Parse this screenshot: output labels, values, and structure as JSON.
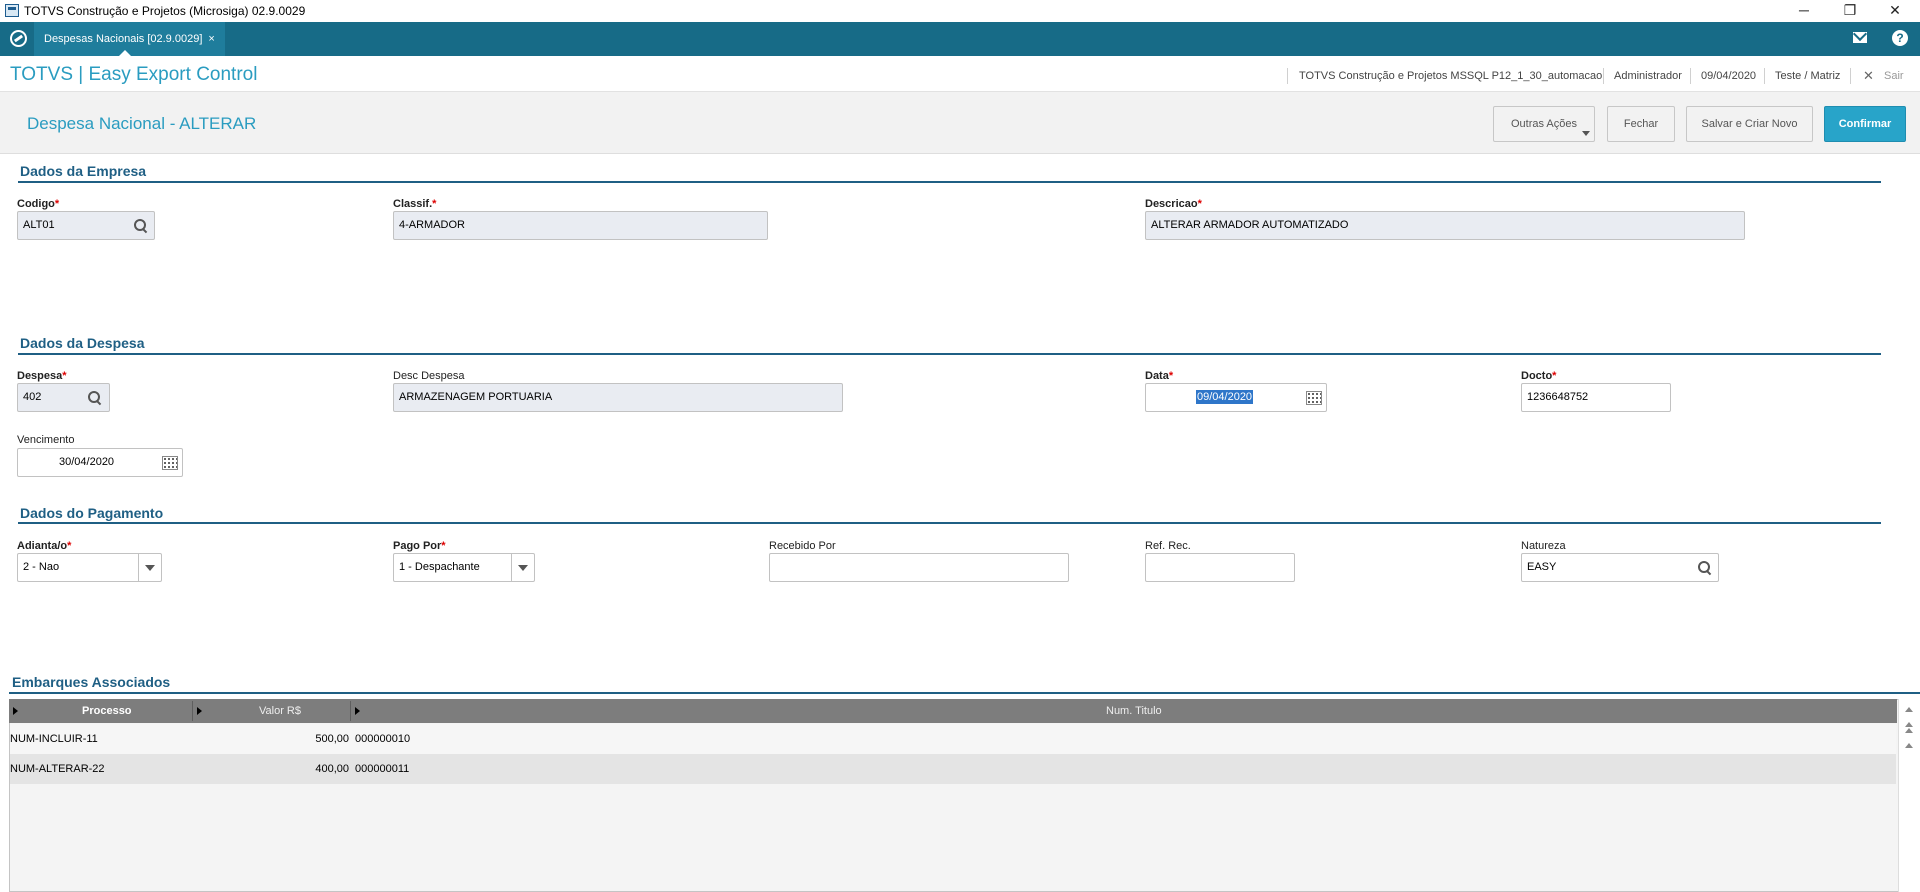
{
  "window": {
    "title": "TOTVS Construção e Projetos (Microsiga) 02.9.0029",
    "min": "─",
    "restore": "❐",
    "close": "✕"
  },
  "tabs": [
    {
      "label": "Despesas Nacionais [02.9.0029]",
      "close": "×"
    }
  ],
  "header": {
    "brand": "TOTVS | Easy Export Control",
    "environment": "TOTVS Construção e Projetos MSSQL P12_1_30_automacao",
    "user": "Administrador",
    "date": "09/04/2020",
    "branch": "Teste / Matriz",
    "exit_icon": "✕",
    "exit": "Sair"
  },
  "page": {
    "title": "Despesa Nacional - ALTERAR",
    "buttons": {
      "other_actions": "Outras Ações",
      "close": "Fechar",
      "save_new": "Salvar e Criar Novo",
      "confirm": "Confirmar"
    }
  },
  "empresa": {
    "section": "Dados da Empresa",
    "codigo": {
      "label": "Codigo",
      "value": "ALT01"
    },
    "classif": {
      "label": "Classif.",
      "value": "4-ARMADOR"
    },
    "descricao": {
      "label": "Descricao",
      "value": "ALTERAR ARMADOR AUTOMATIZADO"
    }
  },
  "despesa": {
    "section": "Dados da Despesa",
    "despesa": {
      "label": "Despesa",
      "value": "402"
    },
    "desc_despesa": {
      "label": "Desc Despesa",
      "value": "ARMAZENAGEM PORTUARIA"
    },
    "data": {
      "label": "Data",
      "value": "09/04/2020"
    },
    "docto": {
      "label": "Docto",
      "value": "1236648752"
    },
    "vencimento": {
      "label": "Vencimento",
      "value": "30/04/2020"
    }
  },
  "pagamento": {
    "section": "Dados do Pagamento",
    "adiantamento": {
      "label": "Adianta/o",
      "value": "2 - Nao"
    },
    "pago_por": {
      "label": "Pago Por",
      "value": "1 - Despachante"
    },
    "recebido_por": {
      "label": "Recebido Por",
      "value": ""
    },
    "ref_rec": {
      "label": "Ref. Rec.",
      "value": ""
    },
    "natureza": {
      "label": "Natureza",
      "value": "EASY"
    }
  },
  "embarques": {
    "section": "Embarques Associados",
    "columns": [
      "Processo",
      "Valor R$",
      "Num. Titulo"
    ],
    "rows": [
      [
        "NUM-INCLUIR-11",
        "500,00",
        "000000010"
      ],
      [
        "NUM-ALTERAR-22",
        "400,00",
        "000000011"
      ]
    ]
  },
  "required_mark": "*",
  "colors": {
    "tabbar": "#176b87",
    "brand": "#2a9cc0",
    "section": "#1f5f84",
    "primary_button": "#28a4c9",
    "required": "#dd0000"
  }
}
